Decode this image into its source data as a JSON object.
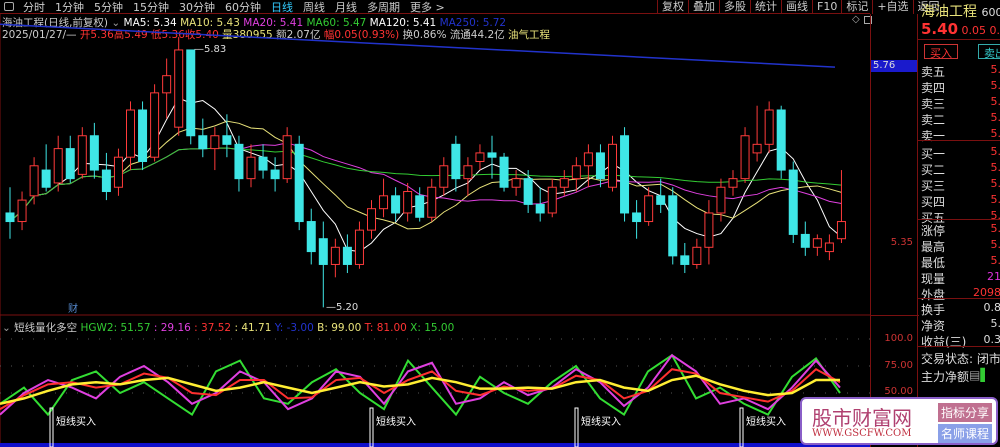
{
  "toolbar": {
    "periods": [
      "分时",
      "1分钟",
      "5分钟",
      "15分钟",
      "30分钟",
      "60分钟",
      "日线",
      "周线",
      "月线",
      "多周期",
      "更多 >"
    ],
    "active": "日线",
    "right_buttons": [
      "复权",
      "叠加",
      "多股",
      "统计",
      "画线",
      "F10",
      "标记",
      "+自选",
      "返回"
    ]
  },
  "info": {
    "title": "海油工程(日线,前复权)",
    "ma5": "MA5: 5.34",
    "ma10": "MA10: 5.43",
    "ma20": "MA20: 5.41",
    "ma60": "MA60: 5.47",
    "ma120": "MA120: 5.41",
    "ma250": "MA250: 5.72",
    "date": "2025/01/27/—",
    "open": "开5.36",
    "high": "高5.49",
    "low": "低5.36",
    "close": "收5.40",
    "vol": "量380955",
    "amt": "额2.07亿",
    "chg": "幅0.05(0.93%)",
    "turn": "换0.86%",
    "flow": "流通44.2亿",
    "sector": "油气工程"
  },
  "annotations": {
    "high_label": "5.83",
    "low_label": "5.20",
    "cai": "财",
    "buy_label": "短线买入"
  },
  "axis": {
    "price_tag": "5.76",
    "price_label": "5.35",
    "ind_labels": [
      "100.0",
      "75.00",
      "50.00"
    ]
  },
  "indicator": {
    "name": "短线量化多空",
    "hgw2": "HGW2: 51.57",
    "v1": ": 29.16",
    "v2": ": 37.52",
    "v3": ": 41.71",
    "y": "Y: -3.00",
    "b": "B: 99.00",
    "t": "T: 81.00",
    "x": "X: 15.00"
  },
  "colors": {
    "up": "#ff3b3b",
    "down": "#3fe6e6",
    "ma5": "#ffffff",
    "ma10": "#e8e27a",
    "ma20": "#e040e0",
    "ma60": "#33cc33",
    "ma250": "#2233cc"
  },
  "panel": {
    "name": "海油工程",
    "code": "600",
    "price": "5.40",
    "chg": "0.05",
    "pct": "0.",
    "buy": "买入",
    "sell": "卖出",
    "rows": [
      [
        "卖五",
        "5."
      ],
      [
        "卖四",
        "5."
      ],
      [
        "卖三",
        "5."
      ],
      [
        "卖二",
        "5."
      ],
      [
        "卖一",
        "5."
      ],
      [
        "买一",
        "5."
      ],
      [
        "买二",
        "5."
      ],
      [
        "买三",
        "5."
      ],
      [
        "买四",
        "5."
      ],
      [
        "买五",
        "5."
      ],
      [
        "涨停",
        "5."
      ],
      [
        "最高",
        "5."
      ],
      [
        "最低",
        "5."
      ],
      [
        "现量",
        "21"
      ],
      [
        "外盘",
        "2098"
      ],
      [
        "换手",
        "0.8"
      ],
      [
        "净资",
        "5."
      ],
      [
        "收益(三)",
        "0.3"
      ]
    ],
    "status": "交易状态: 闭市",
    "net": "主力净额"
  },
  "watermark": {
    "name": "股市财富网",
    "url": "WWW.GSCFW.COM",
    "tag1": "指标分享",
    "tag2": "名师课程"
  },
  "chart_data": {
    "type": "candlestick",
    "ylim": [
      5.15,
      5.9
    ],
    "candles": [
      [
        5.42,
        5.48,
        5.36,
        5.4
      ],
      [
        5.4,
        5.47,
        5.38,
        5.45
      ],
      [
        5.46,
        5.55,
        5.44,
        5.53
      ],
      [
        5.52,
        5.58,
        5.47,
        5.48
      ],
      [
        5.49,
        5.6,
        5.47,
        5.57
      ],
      [
        5.57,
        5.6,
        5.49,
        5.5
      ],
      [
        5.51,
        5.62,
        5.5,
        5.6
      ],
      [
        5.6,
        5.63,
        5.5,
        5.52
      ],
      [
        5.52,
        5.56,
        5.45,
        5.47
      ],
      [
        5.48,
        5.57,
        5.46,
        5.55
      ],
      [
        5.55,
        5.68,
        5.52,
        5.66
      ],
      [
        5.66,
        5.68,
        5.52,
        5.54
      ],
      [
        5.55,
        5.72,
        5.54,
        5.7
      ],
      [
        5.7,
        5.78,
        5.64,
        5.74
      ],
      [
        5.62,
        5.83,
        5.6,
        5.8
      ],
      [
        5.8,
        5.8,
        5.58,
        5.6
      ],
      [
        5.6,
        5.64,
        5.55,
        5.57
      ],
      [
        5.57,
        5.62,
        5.52,
        5.6
      ],
      [
        5.6,
        5.65,
        5.55,
        5.58
      ],
      [
        5.58,
        5.6,
        5.47,
        5.5
      ],
      [
        5.5,
        5.58,
        5.48,
        5.55
      ],
      [
        5.55,
        5.58,
        5.5,
        5.52
      ],
      [
        5.52,
        5.55,
        5.47,
        5.5
      ],
      [
        5.5,
        5.62,
        5.49,
        5.6
      ],
      [
        5.58,
        5.6,
        5.38,
        5.4
      ],
      [
        5.4,
        5.43,
        5.3,
        5.33
      ],
      [
        5.36,
        5.4,
        5.2,
        5.3
      ],
      [
        5.3,
        5.36,
        5.27,
        5.34
      ],
      [
        5.34,
        5.37,
        5.28,
        5.3
      ],
      [
        5.3,
        5.4,
        5.29,
        5.38
      ],
      [
        5.38,
        5.45,
        5.36,
        5.43
      ],
      [
        5.43,
        5.5,
        5.41,
        5.46
      ],
      [
        5.46,
        5.48,
        5.4,
        5.42
      ],
      [
        5.42,
        5.49,
        5.4,
        5.47
      ],
      [
        5.46,
        5.48,
        5.4,
        5.41
      ],
      [
        5.41,
        5.5,
        5.4,
        5.48
      ],
      [
        5.48,
        5.55,
        5.46,
        5.53
      ],
      [
        5.58,
        5.6,
        5.47,
        5.5
      ],
      [
        5.5,
        5.55,
        5.46,
        5.53
      ],
      [
        5.54,
        5.58,
        5.52,
        5.56
      ],
      [
        5.56,
        5.6,
        5.5,
        5.55
      ],
      [
        5.55,
        5.56,
        5.47,
        5.48
      ],
      [
        5.48,
        5.52,
        5.46,
        5.5
      ],
      [
        5.5,
        5.52,
        5.42,
        5.44
      ],
      [
        5.44,
        5.48,
        5.4,
        5.42
      ],
      [
        5.42,
        5.5,
        5.41,
        5.48
      ],
      [
        5.48,
        5.52,
        5.46,
        5.5
      ],
      [
        5.5,
        5.55,
        5.47,
        5.53
      ],
      [
        5.53,
        5.58,
        5.48,
        5.56
      ],
      [
        5.56,
        5.58,
        5.48,
        5.5
      ],
      [
        5.48,
        5.6,
        5.47,
        5.58
      ],
      [
        5.6,
        5.62,
        5.4,
        5.42
      ],
      [
        5.42,
        5.45,
        5.36,
        5.4
      ],
      [
        5.4,
        5.48,
        5.39,
        5.46
      ],
      [
        5.46,
        5.5,
        5.42,
        5.44
      ],
      [
        5.46,
        5.48,
        5.3,
        5.32
      ],
      [
        5.32,
        5.35,
        5.28,
        5.3
      ],
      [
        5.3,
        5.36,
        5.29,
        5.34
      ],
      [
        5.34,
        5.45,
        5.3,
        5.42
      ],
      [
        5.42,
        5.5,
        5.4,
        5.48
      ],
      [
        5.48,
        5.52,
        5.46,
        5.5
      ],
      [
        5.5,
        5.62,
        5.49,
        5.6
      ],
      [
        5.56,
        5.67,
        5.54,
        5.58
      ],
      [
        5.58,
        5.68,
        5.56,
        5.66
      ],
      [
        5.66,
        5.67,
        5.5,
        5.52
      ],
      [
        5.52,
        5.54,
        5.35,
        5.37
      ],
      [
        5.37,
        5.4,
        5.32,
        5.34
      ],
      [
        5.34,
        5.37,
        5.32,
        5.36
      ],
      [
        5.33,
        5.37,
        5.31,
        5.35
      ],
      [
        5.36,
        5.52,
        5.35,
        5.4
      ]
    ],
    "ma250": [
      5.86,
      5.76
    ],
    "osc": {
      "green": [
        40,
        55,
        30,
        62,
        70,
        50,
        60,
        45,
        30,
        70,
        80,
        45,
        40,
        60,
        72,
        50,
        35,
        80,
        55,
        30,
        65,
        50,
        40,
        60,
        75,
        45,
        30,
        70,
        85,
        45,
        55,
        40,
        30,
        65,
        82,
        50
      ],
      "magenta": [
        30,
        50,
        62,
        55,
        45,
        65,
        75,
        60,
        40,
        50,
        70,
        60,
        35,
        45,
        70,
        65,
        40,
        70,
        78,
        40,
        45,
        60,
        48,
        55,
        72,
        60,
        38,
        55,
        85,
        70,
        40,
        45,
        35,
        55,
        80,
        55
      ],
      "red": [
        35,
        48,
        58,
        60,
        55,
        58,
        68,
        64,
        50,
        48,
        62,
        62,
        45,
        46,
        62,
        64,
        50,
        62,
        70,
        52,
        48,
        56,
        52,
        54,
        66,
        62,
        45,
        52,
        72,
        68,
        50,
        46,
        42,
        52,
        72,
        60
      ],
      "yellow": [
        40,
        45,
        52,
        58,
        60,
        58,
        62,
        64,
        58,
        52,
        55,
        60,
        55,
        50,
        55,
        60,
        56,
        58,
        64,
        60,
        54,
        54,
        55,
        54,
        60,
        62,
        55,
        52,
        62,
        66,
        58,
        52,
        48,
        50,
        62,
        62
      ]
    }
  }
}
